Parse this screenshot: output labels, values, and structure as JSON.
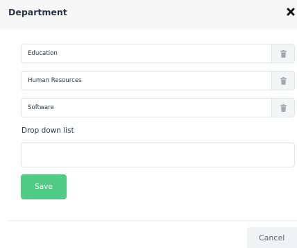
{
  "dialog": {
    "title": "Department",
    "close_icon": "close-x-icon"
  },
  "items": [
    {
      "value": "Education",
      "delete_icon": "trash-icon"
    },
    {
      "value": "Human Resources",
      "delete_icon": "trash-icon"
    },
    {
      "value": "Software",
      "delete_icon": "trash-icon"
    }
  ],
  "dropdown": {
    "label": "Drop down list",
    "value": ""
  },
  "buttons": {
    "save_label": "Save",
    "cancel_label": "Cancel"
  },
  "colors": {
    "save_bg": "#4fcb85",
    "header_bg": "#f7f7f7",
    "cancel_bg": "#f1f2f4",
    "text": "#2b3542",
    "icon_gray": "#a3a8ae"
  }
}
